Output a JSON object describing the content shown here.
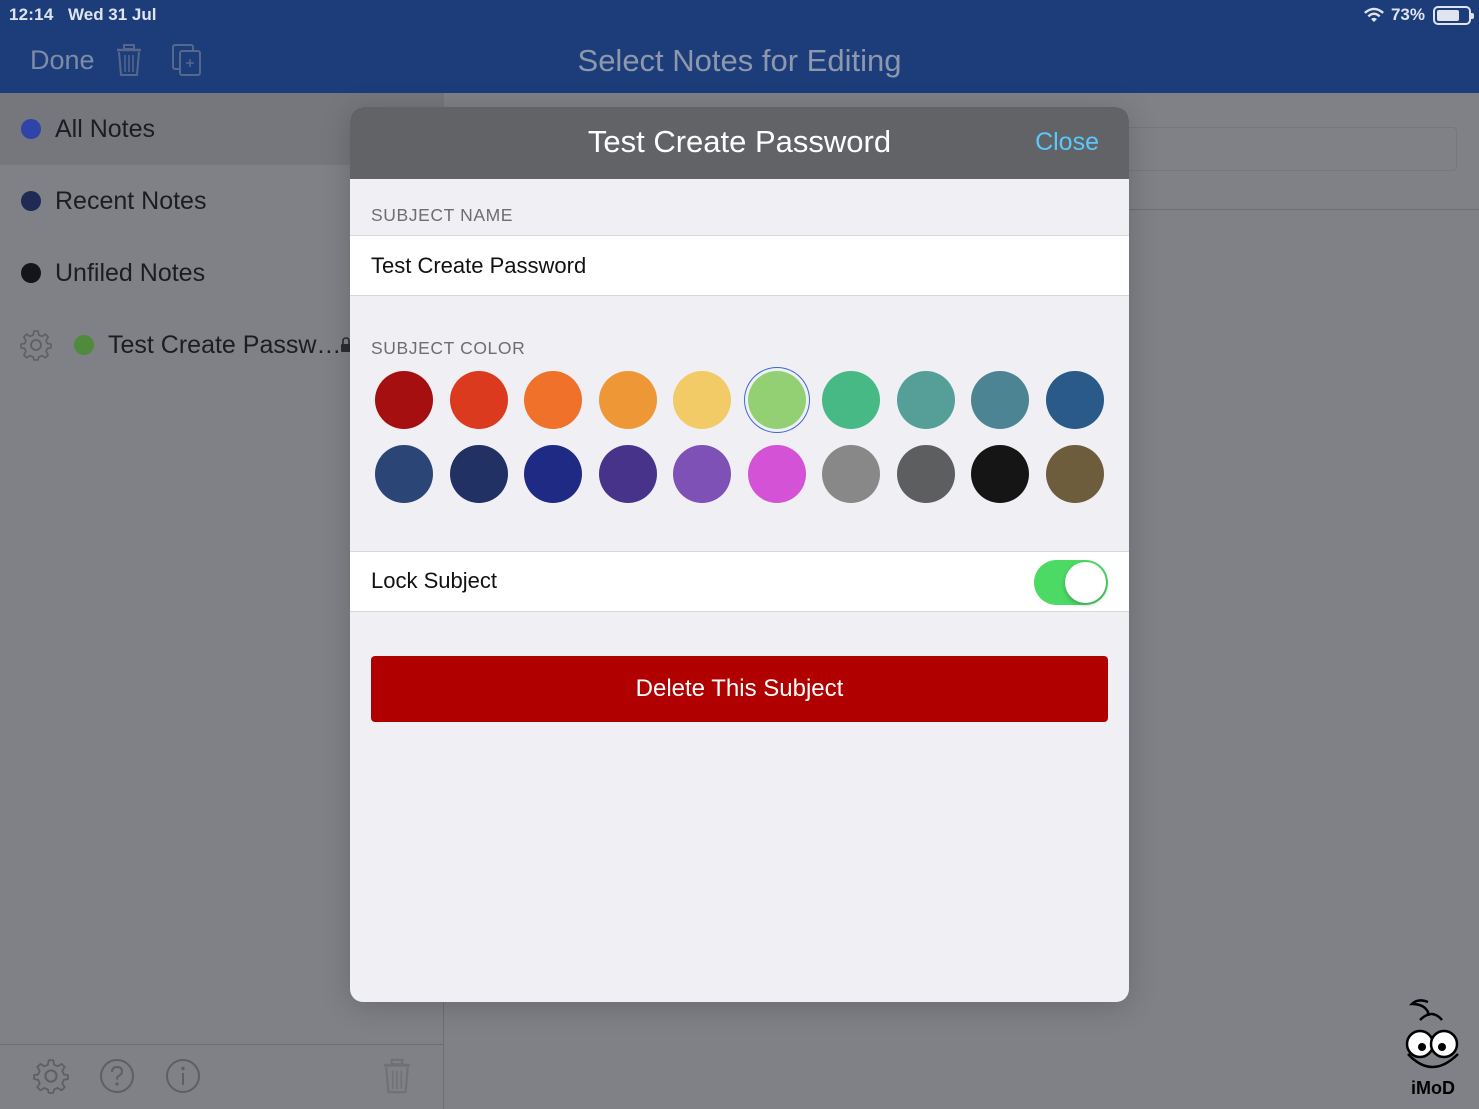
{
  "status_bar": {
    "time": "12:14",
    "date": "Wed 31 Jul",
    "battery": "73%",
    "battery_level": 0.73
  },
  "nav": {
    "done_label": "Done",
    "title": "Select Notes for Editing"
  },
  "sidebar": {
    "items": [
      {
        "label": "All Notes",
        "color": "#2f43a8"
      },
      {
        "label": "Recent Notes",
        "color": "#1f2a55"
      },
      {
        "label": "Unfiled Notes",
        "color": "#141518"
      },
      {
        "label": "Test Create Passw…",
        "color": "#4f8a3d"
      }
    ]
  },
  "modal": {
    "title": "Test Create Password",
    "close_label": "Close",
    "subject_name_label": "SUBJECT NAME",
    "subject_name_value": "Test Create Password",
    "subject_color_label": "SUBJECT COLOR",
    "colors": [
      "#a50f0f",
      "#dc3a1e",
      "#f0712a",
      "#ee9737",
      "#f2ca66",
      "#92d073",
      "#47b985",
      "#569f99",
      "#4d8493",
      "#2a5a8a",
      "#2b4577",
      "#223164",
      "#1f2a85",
      "#47338a",
      "#7e51b6",
      "#d352d5",
      "#888888",
      "#5d5e60",
      "#151515",
      "#6d5d3d"
    ],
    "selected_color_index": 5,
    "lock_label": "Lock Subject",
    "lock_on": true,
    "delete_label": "Delete This Subject"
  },
  "watermark": "iMoD"
}
